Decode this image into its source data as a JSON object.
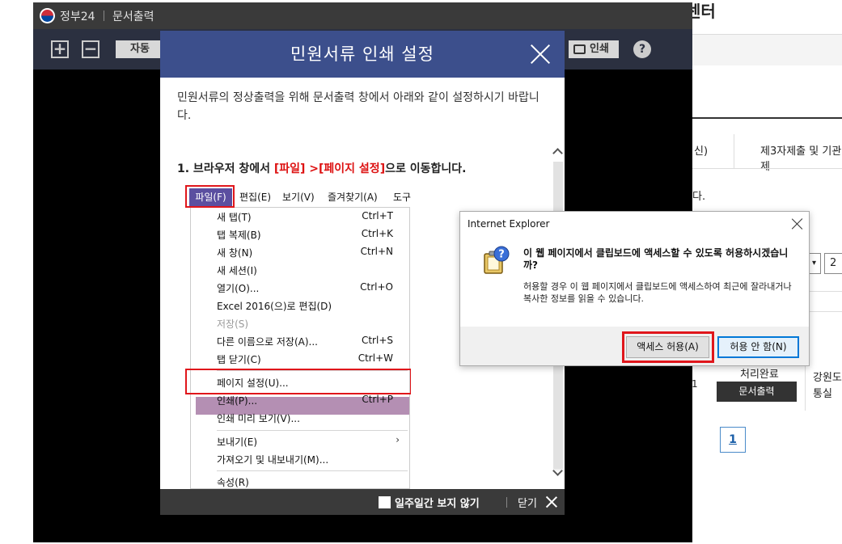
{
  "background": {
    "page_title_fragment": "센터",
    "col1_fragment": "신)",
    "col2_header": "제3자제출 및 기관제",
    "text_fragment": "다.",
    "select_value": "2",
    "row_status": "처리완료",
    "row_button": "문서출력",
    "row_region_1": "강원도",
    "row_region_2": "통실",
    "row_small": "1",
    "pager_current": "1"
  },
  "viewer": {
    "brand": "정부24",
    "title": "문서출력",
    "zoom_in": "+",
    "zoom_out": "−",
    "auto_label": "자동",
    "print_label": "인쇄",
    "help_label": "?"
  },
  "modal": {
    "title": "민원서류 인쇄 설정",
    "intro": "민원서류의 정상출력을 위해 문서출력 창에서 아래와 같이 설정하시기 바랍니다.",
    "step_prefix": "1. 브라우저 창에서 ",
    "step_file": "[파일]",
    "step_arrow": " >",
    "step_page_setup": "[페이지 설정]",
    "step_suffix": "으로 이동합니다.",
    "footer_checkbox_label": "일주일간 보지 않기",
    "footer_close": "닫기"
  },
  "menu": {
    "bar": [
      "파일(F)",
      "편집(E)",
      "보기(V)",
      "즐겨찾기(A)",
      "도구"
    ],
    "items": [
      {
        "label": "새 탭(T)",
        "shortcut": "Ctrl+T"
      },
      {
        "label": "탭 복제(B)",
        "shortcut": "Ctrl+K"
      },
      {
        "label": "새 창(N)",
        "shortcut": "Ctrl+N"
      },
      {
        "label": "새 세션(I)",
        "shortcut": ""
      },
      {
        "label": "열기(O)...",
        "shortcut": "Ctrl+O"
      },
      {
        "label": "Excel 2016(으)로 편집(D)",
        "shortcut": ""
      },
      {
        "label": "저장(S)",
        "shortcut": ""
      },
      {
        "label": "다른 이름으로 저장(A)...",
        "shortcut": "Ctrl+S"
      },
      {
        "label": "탭 닫기(C)",
        "shortcut": "Ctrl+W"
      },
      {
        "label": "페이지 설정(U)...",
        "shortcut": ""
      },
      {
        "label": "인쇄(P)...",
        "shortcut": "Ctrl+P"
      },
      {
        "label": "인쇄 미리 보기(V)...",
        "shortcut": ""
      },
      {
        "label": "보내기(E)",
        "shortcut": ""
      },
      {
        "label": "가져오기 및 내보내기(M)...",
        "shortcut": ""
      },
      {
        "label": "속성(R)",
        "shortcut": ""
      }
    ],
    "submenu_arrow": "›"
  },
  "ie_dialog": {
    "title": "Internet Explorer",
    "question": "이 웹 페이지에서 클립보드에 액세스할 수 있도록 허용하시겠습니까?",
    "description": "허용할 경우 이 웹 페이지에서 클립보드에 액세스하여 최근에 잘라내거나 복사한 정보를 읽을 수 있습니다.",
    "allow_button": "액세스 허용(A)",
    "deny_button": "허용 안 함(N)"
  },
  "colors": {
    "modal_header": "#3c4f8c",
    "highlight_red": "#e0161b",
    "menu_selected": "#5b4fa0",
    "hover_row": "#b48fb3",
    "ie_default_button": "#0078d7"
  }
}
